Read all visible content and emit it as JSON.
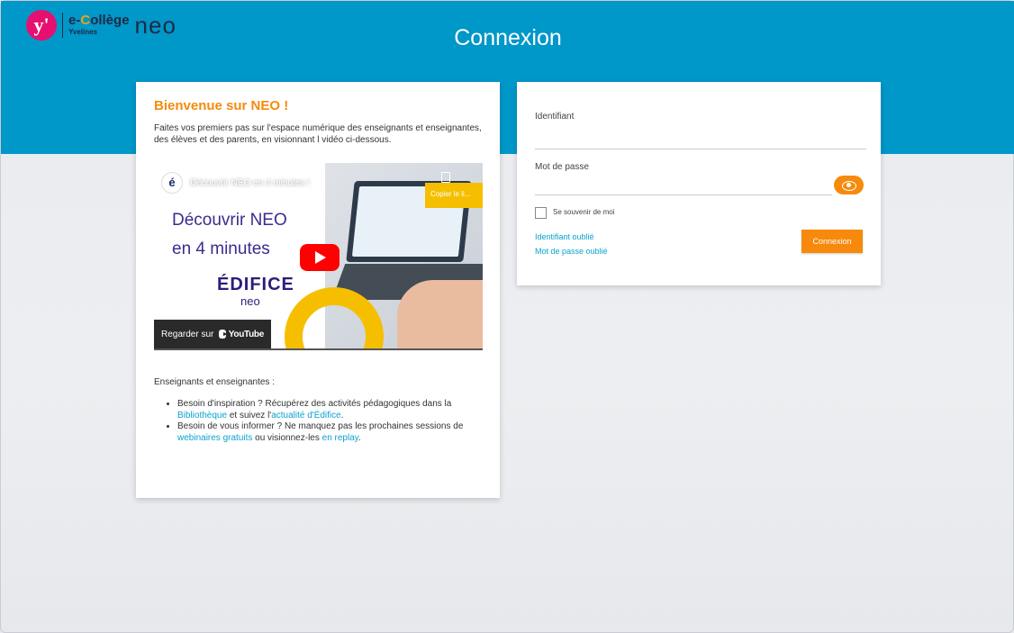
{
  "brand": {
    "logo_letter": "y'",
    "ecollege_prefix": "e-",
    "ecollege_c": "C",
    "ecollege_rest": "ollège",
    "yvelines": "Yvelines",
    "neo": "neo"
  },
  "header": {
    "title": "Connexion"
  },
  "welcome": {
    "title": "Bienvenue sur NEO !",
    "intro": "Faites vos premiers pas sur l'espace numérique des enseignants et enseignantes, des élèves et des parents, en visionnant l vidéo ci-dessous.",
    "video": {
      "channel_letter": "é",
      "title": "Découvrir NEO en 4 minutes !",
      "copy_label": "Copier le li...",
      "headline_1": "Découvrir NEO",
      "headline_2": "en 4 minutes",
      "edifice": "ÉDIFICE",
      "edifice_sub": "neo",
      "watch_on": "Regarder sur",
      "youtube": "YouTube"
    },
    "audience": "Enseignants et enseignantes :",
    "bullets": [
      {
        "text_1": "Besoin d'inspiration ? Récupérez des activités pédagogiques dans la ",
        "link_1": "Bibliothèque",
        "text_2": " et suivez l'",
        "link_2": "actualité d'Édifice",
        "text_3": "."
      },
      {
        "text_1": "Besoin de vous informer ? Ne manquez pas les prochaines sessions de ",
        "link_1": "webinaires gratuits",
        "text_2": " ou visionnez-les ",
        "link_2": "en replay",
        "text_3": "."
      }
    ]
  },
  "login": {
    "identifier_label": "Identifiant",
    "identifier_value": "",
    "password_label": "Mot de passe",
    "password_value": "",
    "remember_label": "Se souvenir de moi",
    "forgot_id": "Identifiant oublié",
    "forgot_password": "Mot de passe oublié",
    "submit": "Connexion"
  },
  "colors": {
    "header_blue": "#0097c9",
    "accent_orange": "#f78a0c",
    "link_blue": "#0aa2d0"
  }
}
